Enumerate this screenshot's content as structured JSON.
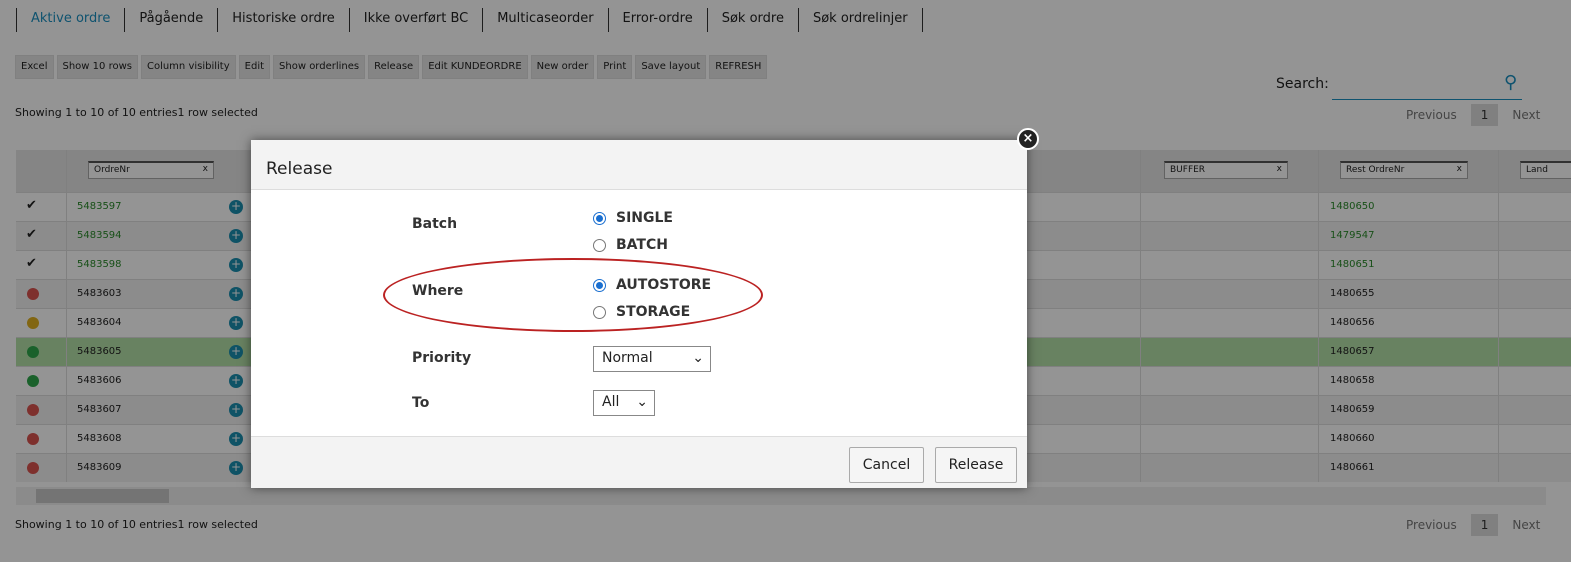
{
  "tabs": [
    "Aktive ordre",
    "Pågående",
    "Historiske ordre",
    "Ikke overført BC",
    "Multicaseorder",
    "Error-ordre",
    "Søk ordre",
    "Søk ordrelinjer"
  ],
  "toolbar": [
    "Excel",
    "Show 10 rows",
    "Column visibility",
    "Edit",
    "Show orderlines",
    "Release",
    "Edit KUNDEORDRE",
    "New order",
    "Print",
    "Save layout",
    "REFRESH"
  ],
  "info": "Showing 1 to 10 of 10 entries1 row selected",
  "search_label": "Search:",
  "pager": {
    "prev": "Previous",
    "page": "1",
    "next": "Next"
  },
  "filters": {
    "ordrenr": "OrdreNr",
    "buffer": "BUFFER",
    "rest": "Rest OrdreNr",
    "land": "Land",
    "clear": "x"
  },
  "rows": [
    {
      "status": "check",
      "ordre": "5483597",
      "rest": "1480650",
      "green": true
    },
    {
      "status": "check",
      "ordre": "5483594",
      "rest": "1479547",
      "green": true
    },
    {
      "status": "check",
      "ordre": "5483598",
      "rest": "1480651",
      "green": true
    },
    {
      "status": "red",
      "ordre": "5483603",
      "rest": "1480655"
    },
    {
      "status": "yellow",
      "ordre": "5483604",
      "rest": "1480656"
    },
    {
      "status": "green",
      "ordre": "5483605",
      "rest": "1480657",
      "selected": true
    },
    {
      "status": "green",
      "ordre": "5483606",
      "rest": "1480658"
    },
    {
      "status": "red",
      "ordre": "5483607",
      "rest": "1480659"
    },
    {
      "status": "red",
      "ordre": "5483608",
      "rest": "1480660"
    },
    {
      "status": "red",
      "ordre": "5483609",
      "rest": "1480661"
    }
  ],
  "colors": {
    "red": "#d9534f",
    "yellow": "#e0b020",
    "green": "#2ea84a",
    "accent": "#1a8fc0"
  },
  "modal": {
    "title": "Release",
    "batch_label": "Batch",
    "batch_options": [
      "SINGLE",
      "BATCH"
    ],
    "batch_selected": "SINGLE",
    "where_label": "Where",
    "where_options": [
      "AUTOSTORE",
      "STORAGE"
    ],
    "where_selected": "AUTOSTORE",
    "priority_label": "Priority",
    "priority_value": "Normal",
    "to_label": "To",
    "to_value": "All",
    "cancel": "Cancel",
    "release": "Release"
  }
}
